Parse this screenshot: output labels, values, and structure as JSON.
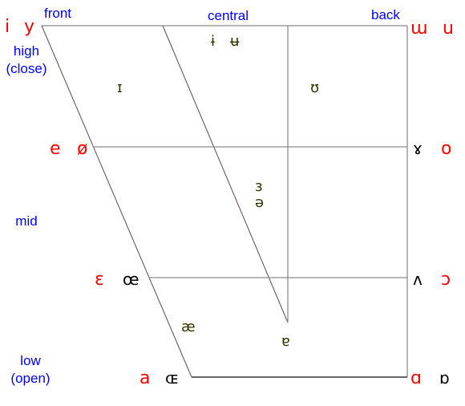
{
  "labels": {
    "front": "front",
    "central": "central",
    "back": "back",
    "high": "high",
    "close": "(close)",
    "mid": "mid",
    "low": "low",
    "open": "(open)"
  },
  "corner_vowels": {
    "close_front_unrounded": "i",
    "close_front_rounded": "y",
    "close_back_unrounded": "ɯ",
    "close_back_rounded": "u",
    "closemid_front_unrounded": "e",
    "closemid_front_rounded": "ø",
    "closemid_back_unrounded": "ɤ",
    "closemid_back_rounded": "o",
    "openmid_front_unrounded": "ɛ",
    "openmid_front_rounded": "œ",
    "openmid_back_unrounded": "ʌ",
    "openmid_back_rounded": "ɔ",
    "open_front_unrounded": "a",
    "open_front_rounded": "ɶ",
    "open_back_unrounded": "ɑ",
    "open_back_rounded": "ɒ"
  },
  "inner_vowels": {
    "close_central_unrounded": "ɨ",
    "close_central_rounded": "ʉ",
    "nearclose_front": "ɪ",
    "nearclose_back": "ʊ",
    "mid_central_openmid": "ɜ",
    "schwa": "ə",
    "nearopen_front": "æ",
    "nearopen_central": "ɐ"
  },
  "colors": {
    "labels": "#0000ff",
    "cardinal": "#ff0000",
    "inner": "#333300"
  }
}
